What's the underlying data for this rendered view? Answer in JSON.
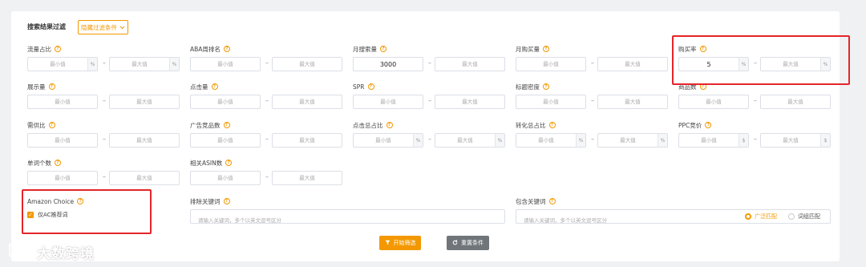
{
  "header": {
    "title": "搜索结果过滤",
    "toggle_label": "隐藏过滤条件"
  },
  "placeholders": {
    "min": "最小值",
    "max": "最大值",
    "keywords": "请输入关键词，多个以英文逗号区分"
  },
  "filters": {
    "traffic_share": {
      "label": "流量占比",
      "unit": "%"
    },
    "aba_rank": {
      "label": "ABA周排名"
    },
    "monthly_search": {
      "label": "月搜索量",
      "min_value": "3000"
    },
    "monthly_purchase": {
      "label": "月购买量"
    },
    "purchase_rate": {
      "label": "购买率",
      "min_value": "5",
      "unit": "%"
    },
    "impressions": {
      "label": "展示量"
    },
    "clicks": {
      "label": "点击量"
    },
    "spr": {
      "label": "SPR"
    },
    "title_density": {
      "label": "标题密度"
    },
    "product_count": {
      "label": "商品数"
    },
    "supply_demand": {
      "label": "需供比"
    },
    "ad_products": {
      "label": "广告竞品数"
    },
    "click_share": {
      "label": "点击总占比",
      "unit": "%"
    },
    "conversion_share": {
      "label": "转化总占比",
      "unit": "%"
    },
    "ppc_bid": {
      "label": "PPC竞价",
      "unit": "$"
    },
    "word_count": {
      "label": "单词个数"
    },
    "related_asin": {
      "label": "相关ASIN数"
    }
  },
  "amazon_choice": {
    "label": "Amazon Choice",
    "checkbox_label": "仅AC推荐词",
    "checked": true
  },
  "exclude_keywords": {
    "label": "排除关键词"
  },
  "include_keywords": {
    "label": "包含关键词",
    "match_broad": "广泛匹配",
    "match_root": "词组匹配",
    "selected": "广泛匹配"
  },
  "actions": {
    "start": "开始筛选",
    "reset": "重置条件"
  },
  "watermark": "大数跨境",
  "colors": {
    "accent": "#f39800",
    "highlight": "#e5252a",
    "reset_button": "#707579"
  }
}
